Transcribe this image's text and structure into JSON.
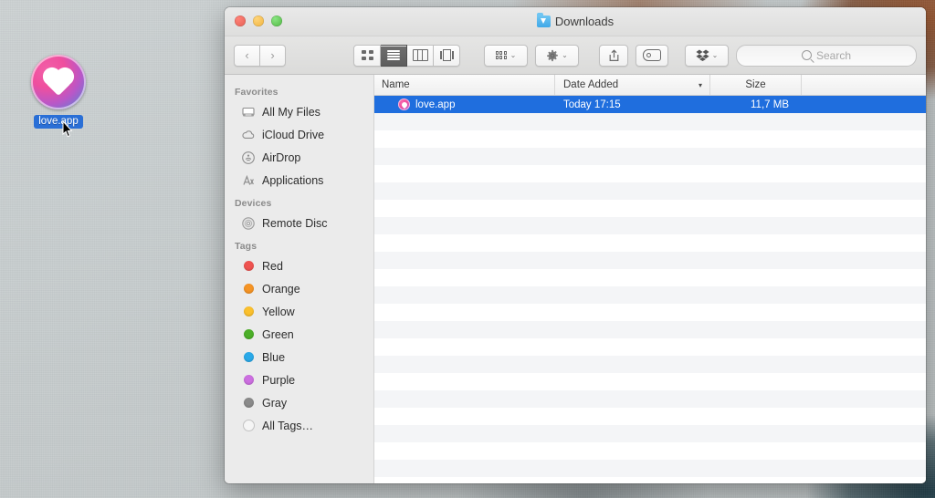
{
  "desktop": {
    "icon": {
      "name": "love.app",
      "glyph": "heart-app-icon",
      "selected": true
    },
    "cursor": "arrow-pointer"
  },
  "window": {
    "title": "Downloads",
    "title_icon": "downloads-folder-icon",
    "traffic_lights": [
      {
        "name": "close",
        "color": "#ec6a5f"
      },
      {
        "name": "minimize",
        "color": "#f4bd4f"
      },
      {
        "name": "zoom",
        "color": "#61c555"
      }
    ],
    "toolbar": {
      "back_label": "‹",
      "forward_label": "›",
      "view_modes": [
        {
          "name": "icon-view",
          "active": false
        },
        {
          "name": "list-view",
          "active": true
        },
        {
          "name": "column-view",
          "active": false
        },
        {
          "name": "coverflow-view",
          "active": false
        }
      ],
      "arrange_label": "arrange-by",
      "action_label": "action-gear",
      "share_label": "share",
      "tag_label": "edit-tags",
      "dropbox_label": "dropbox",
      "chevron": "⌄"
    },
    "search": {
      "placeholder": "Search",
      "value": ""
    }
  },
  "sidebar": {
    "sections": [
      {
        "title": "Favorites",
        "items": [
          {
            "label": "All My Files",
            "icon": "all-my-files-icon"
          },
          {
            "label": "iCloud Drive",
            "icon": "icloud-drive-icon"
          },
          {
            "label": "AirDrop",
            "icon": "airdrop-icon"
          },
          {
            "label": "Applications",
            "icon": "applications-icon"
          }
        ]
      },
      {
        "title": "Devices",
        "items": [
          {
            "label": "Remote Disc",
            "icon": "remote-disc-icon"
          }
        ]
      },
      {
        "title": "Tags",
        "items": [
          {
            "label": "Red",
            "icon": "tag-dot",
            "color": "#ef5350"
          },
          {
            "label": "Orange",
            "icon": "tag-dot",
            "color": "#f59425"
          },
          {
            "label": "Yellow",
            "icon": "tag-dot",
            "color": "#fbc02d"
          },
          {
            "label": "Green",
            "icon": "tag-dot",
            "color": "#4caf28"
          },
          {
            "label": "Blue",
            "icon": "tag-dot",
            "color": "#2aa9e8"
          },
          {
            "label": "Purple",
            "icon": "tag-dot",
            "color": "#cc6fe0"
          },
          {
            "label": "Gray",
            "icon": "tag-dot",
            "color": "#8a8a8a"
          },
          {
            "label": "All Tags…",
            "icon": "tag-dot-hollow",
            "color": "#dcdcdc"
          }
        ]
      }
    ]
  },
  "filelist": {
    "columns": [
      {
        "label": "Name",
        "sorted": false
      },
      {
        "label": "Date Added",
        "sorted": true
      },
      {
        "label": "Size",
        "sorted": false
      }
    ],
    "rows": [
      {
        "name": "love.app",
        "date_added": "Today 17:15",
        "size": "11,7 MB",
        "icon": "love-app-icon",
        "selected": true
      }
    ],
    "empty_row_count": 22
  },
  "colors": {
    "selection_blue": "#1f6ede",
    "sidebar_bg": "#ebebeb",
    "stripe": "#f4f5f7"
  }
}
